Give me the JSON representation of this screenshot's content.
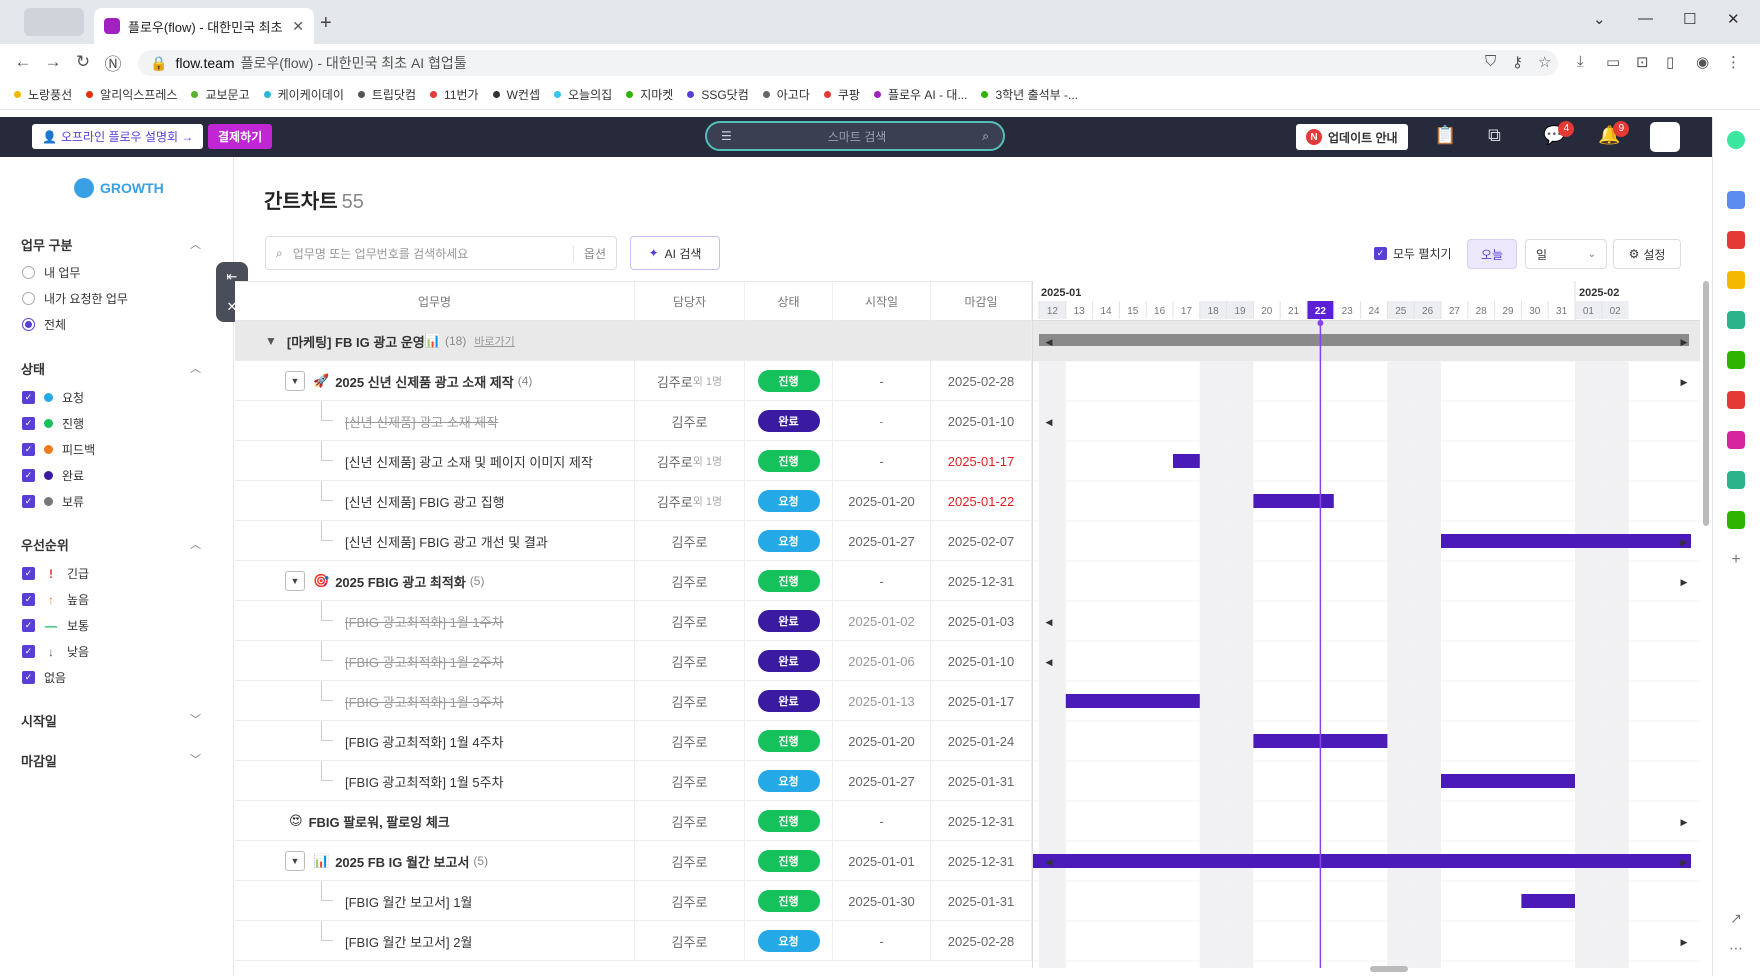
{
  "browser": {
    "tab_title": "플로우(flow) - 대한민국 최초",
    "url_domain": "flow.team",
    "url_title": "플로우(flow) - 대한민국 최초 AI 협업툴",
    "bookmarks": [
      {
        "label": "노랑풍선",
        "color": "#f5b800"
      },
      {
        "label": "알리익스프레스",
        "color": "#e62e04"
      },
      {
        "label": "교보문고",
        "color": "#5bb030"
      },
      {
        "label": "케이케이데이",
        "color": "#29b6d8"
      },
      {
        "label": "트립닷컴",
        "color": "#555555"
      },
      {
        "label": "11번가",
        "color": "#e53935"
      },
      {
        "label": "W컨셉",
        "color": "#333333"
      },
      {
        "label": "오늘의집",
        "color": "#35c5f0"
      },
      {
        "label": "지마켓",
        "color": "#2db400"
      },
      {
        "label": "SSG닷컴",
        "color": "#5a3fd6"
      },
      {
        "label": "아고다",
        "color": "#666666"
      },
      {
        "label": "쿠팡",
        "color": "#e53935"
      },
      {
        "label": "플로우 AI - 대...",
        "color": "#a020c0"
      },
      {
        "label": "3학년 출석부 -...",
        "color": "#2db400"
      }
    ]
  },
  "header": {
    "offline_btn": "오프라인 플로우 설명회 →",
    "pay_btn": "결제하기",
    "search_placeholder": "스마트 검색",
    "update_btn": "업데이트 안내",
    "update_icon": "N",
    "chat_badge": "4",
    "bell_badge": "9"
  },
  "sidebar": {
    "logo": "GROWTH",
    "task_section": "업무 구분",
    "task_options": [
      "내 업무",
      "내가 요청한 업무",
      "전체"
    ],
    "status_section": "상태",
    "status_options": [
      {
        "label": "요청",
        "color": "#25a8e6"
      },
      {
        "label": "진행",
        "color": "#14c15a"
      },
      {
        "label": "피드백",
        "color": "#f07c1a"
      },
      {
        "label": "완료",
        "color": "#3a1aa0"
      },
      {
        "label": "보류",
        "color": "#777777"
      }
    ],
    "priority_section": "우선순위",
    "priority_options": [
      {
        "label": "긴급",
        "icon": "!",
        "color": "#e53935"
      },
      {
        "label": "높음",
        "icon": "↑",
        "color": "#f07c1a"
      },
      {
        "label": "보통",
        "icon": "—",
        "color": "#14c15a"
      },
      {
        "label": "낮음",
        "icon": "↓",
        "color": "#555555"
      },
      {
        "label": "없음",
        "icon": "",
        "color": "#555555"
      }
    ],
    "start_section": "시작일",
    "end_section": "마감일"
  },
  "main": {
    "title": "간트차트",
    "count": "55",
    "search_placeholder": "업무명 또는 업무번호를 검색하세요",
    "search_option": "옵션",
    "ai_search": "AI 검색",
    "expand_all": "모두 펼치기",
    "today": "오늘",
    "unit": "일",
    "settings": "설정"
  },
  "table": {
    "headers": [
      "업무명",
      "담당자",
      "상태",
      "시작일",
      "마감일"
    ],
    "group": {
      "name": "[마케팅] FB IG 광고 운영",
      "count": "(18)",
      "link": "바로가기"
    },
    "rows": [
      {
        "level": 1,
        "toggle": true,
        "icon": "🚀",
        "name": "2025 신년 신제품 광고 소재 제작",
        "count": "(4)",
        "who": "김주로",
        "extra": "외 1명",
        "status": "진행",
        "st": "go",
        "start": "-",
        "end": "2025-02-28"
      },
      {
        "level": 2,
        "name": "[신년 신제품] 광고 소재 제작",
        "strike": true,
        "who": "김주로",
        "status": "완료",
        "st": "done",
        "start": "-",
        "end": "2025-01-10"
      },
      {
        "level": 2,
        "name": "[신년 신제품] 광고 소재 및 페이지 이미지 제작",
        "who": "김주로",
        "extra": "외 1명",
        "status": "진행",
        "st": "go",
        "start": "-",
        "end": "2025-01-17",
        "endRed": true
      },
      {
        "level": 2,
        "name": "[신년 신제품] FBIG 광고 집행",
        "who": "김주로",
        "extra": "외 1명",
        "status": "요청",
        "st": "req",
        "start": "2025-01-20",
        "end": "2025-01-22",
        "endRed": true
      },
      {
        "level": 2,
        "name": "[신년 신제품] FBIG 광고 개선 및 결과",
        "who": "김주로",
        "status": "요청",
        "st": "req",
        "start": "2025-01-27",
        "end": "2025-02-07"
      },
      {
        "level": 1,
        "toggle": true,
        "icon": "🎯",
        "name": "2025 FBIG 광고 최적화",
        "count": "(5)",
        "who": "김주로",
        "status": "진행",
        "st": "go",
        "start": "-",
        "end": "2025-12-31"
      },
      {
        "level": 2,
        "name": "[FBIG 광고최적화] 1월 1주차",
        "strike": true,
        "who": "김주로",
        "status": "완료",
        "st": "done",
        "start": "2025-01-02",
        "end": "2025-01-03"
      },
      {
        "level": 2,
        "name": "[FBIG 광고최적화] 1월 2주차",
        "strike": true,
        "who": "김주로",
        "status": "완료",
        "st": "done",
        "start": "2025-01-06",
        "end": "2025-01-10"
      },
      {
        "level": 2,
        "name": "[FBIG 광고최적화] 1월 3주차",
        "strike": true,
        "who": "김주로",
        "status": "완료",
        "st": "done",
        "start": "2025-01-13",
        "end": "2025-01-17"
      },
      {
        "level": 2,
        "name": "[FBIG 광고최적화] 1월 4주차",
        "who": "김주로",
        "status": "진행",
        "st": "go",
        "start": "2025-01-20",
        "end": "2025-01-24"
      },
      {
        "level": 2,
        "name": "[FBIG 광고최적화] 1월 5주차",
        "who": "김주로",
        "status": "요청",
        "st": "req",
        "start": "2025-01-27",
        "end": "2025-01-31"
      },
      {
        "level": 1,
        "icon": "😍",
        "name": "FBIG 팔로워, 팔로잉 체크",
        "who": "김주로",
        "status": "진행",
        "st": "go",
        "start": "-",
        "end": "2025-12-31"
      },
      {
        "level": 1,
        "toggle": true,
        "icon": "📊",
        "name": "2025 FB IG 월간 보고서",
        "count": "(5)",
        "who": "김주로",
        "status": "진행",
        "st": "go",
        "start": "2025-01-01",
        "end": "2025-12-31"
      },
      {
        "level": 2,
        "name": "[FBIG 월간 보고서] 1월",
        "who": "김주로",
        "status": "진행",
        "st": "go",
        "start": "2025-01-30",
        "end": "2025-01-31"
      },
      {
        "level": 2,
        "name": "[FBIG 월간 보고서] 2월",
        "who": "김주로",
        "status": "요청",
        "st": "req",
        "start": "-",
        "end": "2025-02-28"
      }
    ]
  },
  "gantt": {
    "month_left": "2025-01",
    "month_right": "2025-02",
    "days": [
      "12",
      "13",
      "14",
      "15",
      "16",
      "17",
      "18",
      "19",
      "20",
      "21",
      "22",
      "23",
      "24",
      "25",
      "26",
      "27",
      "28",
      "29",
      "30",
      "31",
      "01",
      "02"
    ],
    "today": "22",
    "weekend_days": [
      "12",
      "18",
      "19",
      "25",
      "26",
      "01",
      "02"
    ],
    "bar_color": "#4a1bb8"
  }
}
